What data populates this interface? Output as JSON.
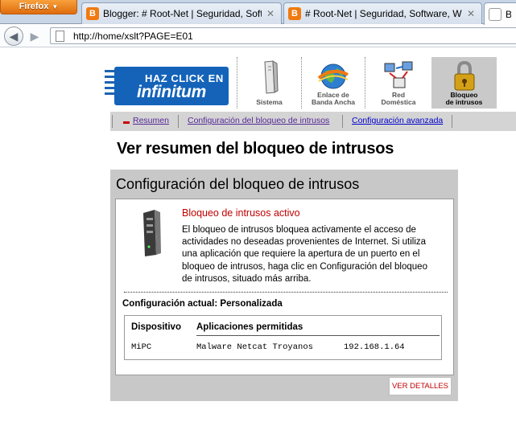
{
  "browser": {
    "menu_button": "Firefox",
    "tabs": [
      {
        "label": "Blogger: # Root-Net | Seguridad, Soft...",
        "favicon": "B",
        "active": false
      },
      {
        "label": "# Root-Net | Seguridad, Software, Wi...",
        "favicon": "B",
        "active": false
      },
      {
        "label": "Bl",
        "favicon": "",
        "active": true
      }
    ],
    "close_glyph": "✕",
    "url": "http://home/xslt?PAGE=E01"
  },
  "header": {
    "logo_line1": "HAZ CLICK EN",
    "logo_line2": "infinitum",
    "nav": [
      {
        "label_line1": "Sistema",
        "label_line2": "",
        "icon": "tower-icon"
      },
      {
        "label_line1": "Enlace de",
        "label_line2": "Banda Ancha",
        "icon": "globe-icon"
      },
      {
        "label_line1": "Red",
        "label_line2": "Doméstica",
        "icon": "network-icon"
      },
      {
        "label_line1": "Bloqueo",
        "label_line2": "de intrusos",
        "icon": "padlock-icon"
      }
    ]
  },
  "subnav": {
    "summary": "Resumen",
    "config": "Configuración del bloqueo de intrusos",
    "advanced": "Configuración avanzada"
  },
  "page": {
    "title": "Ver resumen del bloqueo de intrusos",
    "panel_title": "Configuración del bloqueo de intrusos",
    "status_title": "Bloqueo de intrusos activo",
    "status_desc": "El bloqueo de intrusos bloquea activamente el acceso de actividades no deseadas provenientes de Internet. Si utiliza una aplicación que requiere la apertura de un puerto en el bloqueo de intrusos, haga clic en Configuración del bloqueo de intrusos, situado más arriba.",
    "config_label": "Configuración actual: Personalizada",
    "table": {
      "col_device": "Dispositivo",
      "col_apps": "Aplicaciones permitidas",
      "row_device": "MiPC",
      "row_apps": "Malware Netcat Troyanos",
      "row_ip": "192.168.1.64"
    },
    "details_button": "VER DETALLES"
  },
  "colors": {
    "accent_red": "#c00000",
    "logo_blue": "#1463b9",
    "panel_gray": "#c8c8c8"
  }
}
